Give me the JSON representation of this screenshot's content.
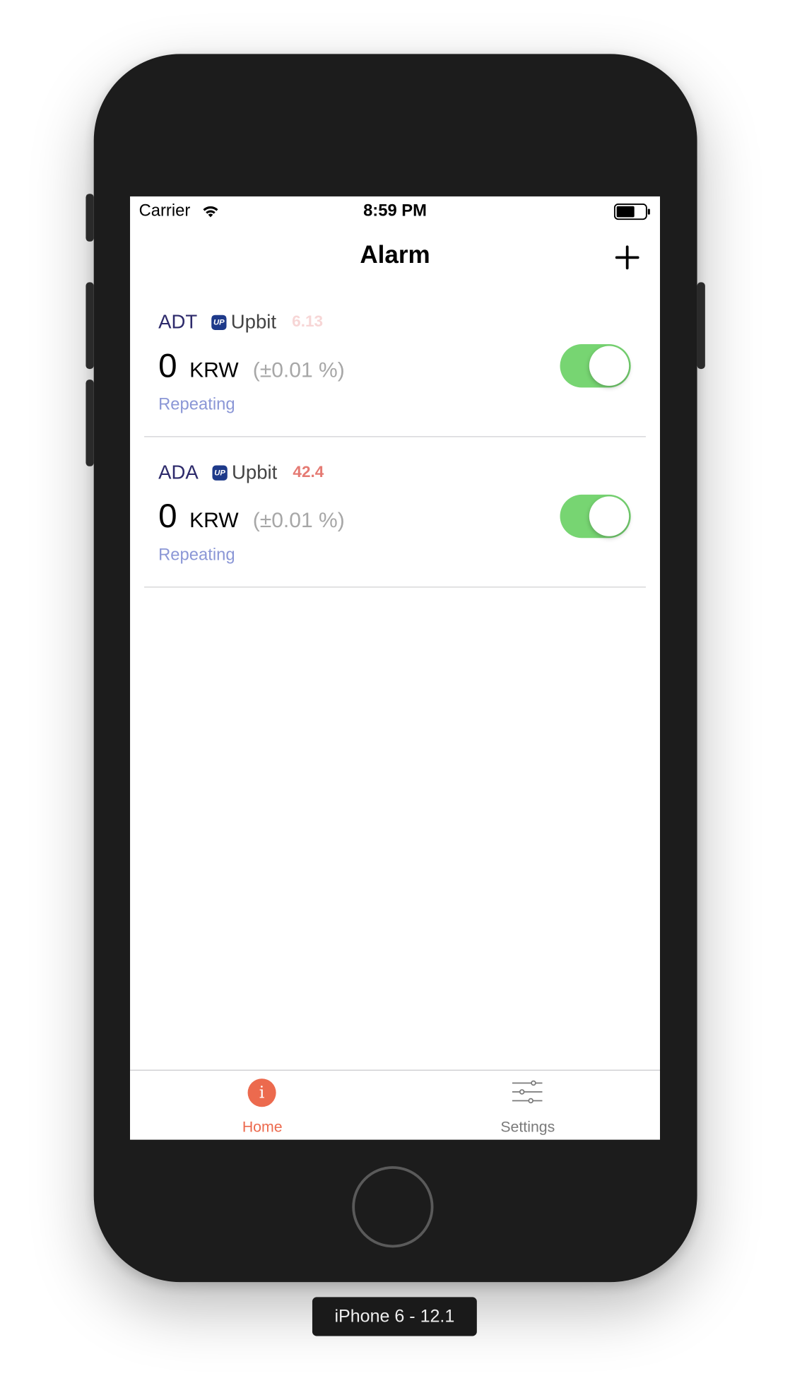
{
  "status_bar": {
    "carrier": "Carrier",
    "time": "8:59 PM",
    "wifi_icon": "wifi-icon",
    "battery_icon": "battery-icon"
  },
  "nav": {
    "title": "Alarm",
    "add_icon": "plus-icon"
  },
  "alarms": [
    {
      "symbol": "ADT",
      "exchange_logo": "UP",
      "exchange": "Upbit",
      "price": "6.13",
      "price_color": "#f7d6d6",
      "target": "0",
      "currency": "KRW",
      "tolerance": "(±0.01 %)",
      "repeat": "Repeating",
      "enabled": true
    },
    {
      "symbol": "ADA",
      "exchange_logo": "UP",
      "exchange": "Upbit",
      "price": "42.4",
      "price_color": "#e57a73",
      "target": "0",
      "currency": "KRW",
      "tolerance": "(±0.01 %)",
      "repeat": "Repeating",
      "enabled": true
    }
  ],
  "tabs": [
    {
      "label": "Home",
      "icon": "info-icon",
      "active": true
    },
    {
      "label": "Settings",
      "icon": "sliders-icon",
      "active": false
    }
  ],
  "colors": {
    "accent": "#ec6a4e",
    "toggle_on": "#77d572",
    "symbol": "#2d2a6b",
    "repeat": "#8b97d6",
    "tab_inactive": "#7a7a7a"
  },
  "device_label": "iPhone 6 - 12.1"
}
